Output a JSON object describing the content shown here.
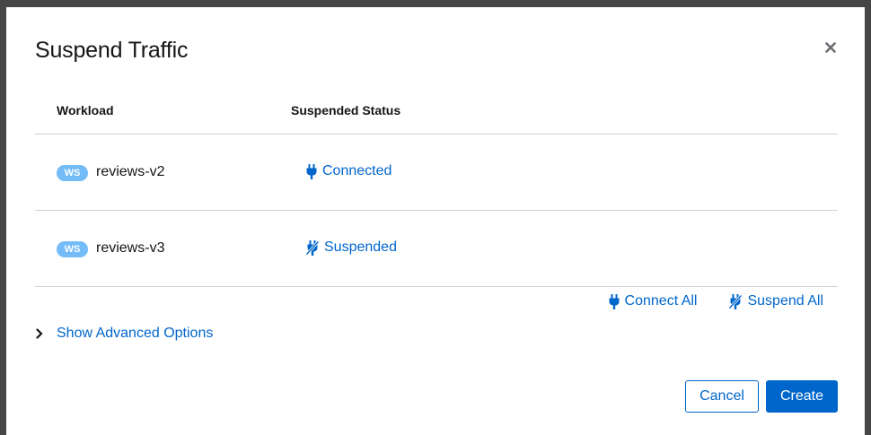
{
  "modal": {
    "title": "Suspend Traffic",
    "close_icon": "close-icon"
  },
  "table": {
    "headers": [
      "Workload",
      "Suspended Status"
    ],
    "rows": [
      {
        "badge": "WS",
        "name": "reviews-v2",
        "status": "Connected",
        "status_icon": "plug-connected-icon"
      },
      {
        "badge": "WS",
        "name": "reviews-v3",
        "status": "Suspended",
        "status_icon": "plug-disconnected-icon"
      }
    ]
  },
  "bulk": {
    "connect_all": "Connect All",
    "suspend_all": "Suspend All"
  },
  "advanced": {
    "label": "Show Advanced Options",
    "icon": "chevron-right-icon"
  },
  "footer": {
    "cancel": "Cancel",
    "create": "Create"
  },
  "colors": {
    "link": "#0066cc",
    "badge": "#73bcf7",
    "primary": "#0066cc",
    "backdrop": "#464646"
  }
}
